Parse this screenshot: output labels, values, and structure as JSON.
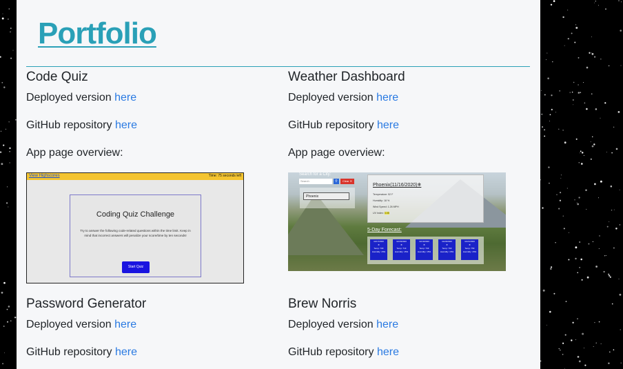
{
  "portfolio": {
    "title": "Portfolio",
    "accent_color": "#2aa0b7",
    "link_color": "#2a7ae2"
  },
  "projects": [
    {
      "title": "Code Quiz",
      "deployed_prefix": "Deployed version",
      "deployed_link": "here",
      "repo_prefix": "GitHub repository",
      "repo_link": "here",
      "overview_label": "App page overview:",
      "screenshot": {
        "top_link": "View Highscores",
        "timer": "Time: 75 seconds left",
        "heading": "Coding Quiz Challenge",
        "body": "Try to answer the following code-related questions within the time limit. Keep in mind that incorrect answers will penalize your score/time by ten seconds!",
        "button": "Start Quiz"
      }
    },
    {
      "title": "Weather Dashboard",
      "deployed_prefix": "Deployed version",
      "deployed_link": "here",
      "repo_prefix": "GitHub repository",
      "repo_link": "here",
      "overview_label": "App page overview:",
      "screenshot": {
        "search_label": "Search for a City:",
        "search_placeholder": "Search",
        "clear_button": "Clear",
        "history_item": "Phoenix",
        "city_heading": "Phoenix(11/16/2020)",
        "temperature": "Temperature: 52 F",
        "humidity": "Humidity: 18 %",
        "wind": "Wind Speed: 1.26 MPH",
        "uv_label": "UV Index:",
        "uv_value": "3.05",
        "forecast_title": "5-Day Forecast:",
        "forecast": [
          {
            "date": "11/17/2020",
            "temp": "Temp: 70F",
            "humidity": "Humidity: 15%"
          },
          {
            "date": "11/18/2020",
            "temp": "Temp: 71F",
            "humidity": "Humidity: 15%"
          },
          {
            "date": "11/19/2020",
            "temp": "Temp: 73F",
            "humidity": "Humidity: 15%"
          },
          {
            "date": "11/20/2020",
            "temp": "Temp: 76F",
            "humidity": "Humidity: 15%"
          },
          {
            "date": "11/21/2020",
            "temp": "Temp: 75F",
            "humidity": "Humidity: 15%"
          }
        ]
      }
    },
    {
      "title": "Password Generator",
      "deployed_prefix": "Deployed version",
      "deployed_link": "here",
      "repo_prefix": "GitHub repository",
      "repo_link": "here"
    },
    {
      "title": "Brew Norris",
      "deployed_prefix": "Deployed version",
      "deployed_link": "here",
      "repo_prefix": "GitHub repository",
      "repo_link": "here"
    }
  ]
}
